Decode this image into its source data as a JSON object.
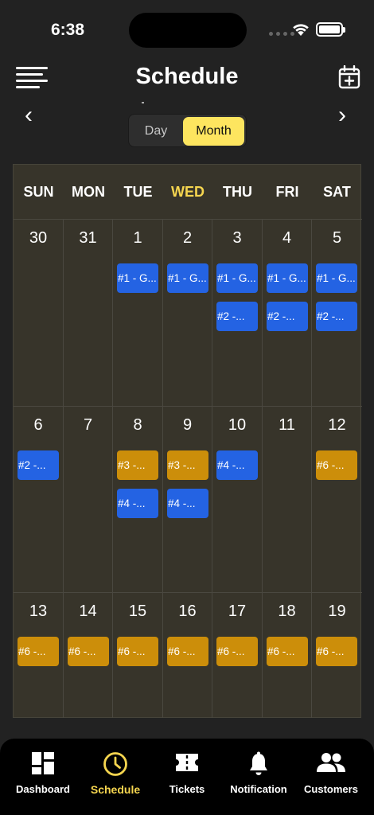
{
  "status_bar": {
    "time": "6:38"
  },
  "header": {
    "title": "Schedule",
    "menu_icon": "menu-icon",
    "action_icon": "calendar-add-icon"
  },
  "navigation": {
    "prev": "‹",
    "next": "›"
  },
  "view_toggle": {
    "day_label": "Day",
    "month_label": "Month",
    "selected": "Month"
  },
  "colors": {
    "accent": "#fde55f",
    "event_blue": "#2463e3",
    "event_gold": "#cc8e0a",
    "today_header": "#f5d54f"
  },
  "weekdays": [
    "SUN",
    "MON",
    "TUE",
    "WED",
    "THU",
    "FRI",
    "SAT"
  ],
  "today_weekday": "WED",
  "weeks": [
    {
      "days": [
        {
          "num": "30",
          "events": []
        },
        {
          "num": "31",
          "events": []
        },
        {
          "num": "1",
          "events": [
            {
              "label": "#1 - G...",
              "color": "blue"
            }
          ]
        },
        {
          "num": "2",
          "events": [
            {
              "label": "#1 - G...",
              "color": "blue"
            }
          ]
        },
        {
          "num": "3",
          "events": [
            {
              "label": "#1 - G...",
              "color": "blue"
            },
            {
              "label": "#2 -...",
              "color": "blue"
            }
          ]
        },
        {
          "num": "4",
          "events": [
            {
              "label": "#1 - G...",
              "color": "blue"
            },
            {
              "label": "#2 -...",
              "color": "blue"
            }
          ]
        },
        {
          "num": "5",
          "events": [
            {
              "label": "#1 - G...",
              "color": "blue"
            },
            {
              "label": "#2 -...",
              "color": "blue"
            }
          ]
        }
      ]
    },
    {
      "days": [
        {
          "num": "6",
          "events": [
            {
              "label": "#2 -...",
              "color": "blue"
            }
          ]
        },
        {
          "num": "7",
          "events": []
        },
        {
          "num": "8",
          "events": [
            {
              "label": "#3 -...",
              "color": "gold"
            },
            {
              "label": "#4 -...",
              "color": "blue"
            }
          ]
        },
        {
          "num": "9",
          "events": [
            {
              "label": "#3 -...",
              "color": "gold"
            },
            {
              "label": "#4 -...",
              "color": "blue"
            }
          ]
        },
        {
          "num": "10",
          "events": [
            {
              "label": "#4 -...",
              "color": "blue"
            }
          ]
        },
        {
          "num": "11",
          "events": []
        },
        {
          "num": "12",
          "events": [
            {
              "label": "#6 -...",
              "color": "gold"
            }
          ]
        }
      ]
    },
    {
      "days": [
        {
          "num": "13",
          "events": [
            {
              "label": "#6 -...",
              "color": "gold"
            }
          ]
        },
        {
          "num": "14",
          "events": [
            {
              "label": "#6 -...",
              "color": "gold"
            }
          ]
        },
        {
          "num": "15",
          "events": [
            {
              "label": "#6 -...",
              "color": "gold"
            }
          ]
        },
        {
          "num": "16",
          "events": [
            {
              "label": "#6 -...",
              "color": "gold"
            }
          ]
        },
        {
          "num": "17",
          "events": [
            {
              "label": "#6 -...",
              "color": "gold"
            }
          ]
        },
        {
          "num": "18",
          "events": [
            {
              "label": "#6 -...",
              "color": "gold"
            }
          ]
        },
        {
          "num": "19",
          "events": [
            {
              "label": "#6 -...",
              "color": "gold"
            }
          ]
        }
      ]
    }
  ],
  "tabs": [
    {
      "label": "Dashboard",
      "icon": "dashboard-icon",
      "active": false
    },
    {
      "label": "Schedule",
      "icon": "clock-icon",
      "active": true
    },
    {
      "label": "Tickets",
      "icon": "ticket-icon",
      "active": false
    },
    {
      "label": "Notification",
      "icon": "bell-icon",
      "active": false
    },
    {
      "label": "Customers",
      "icon": "customers-icon",
      "active": false
    }
  ]
}
